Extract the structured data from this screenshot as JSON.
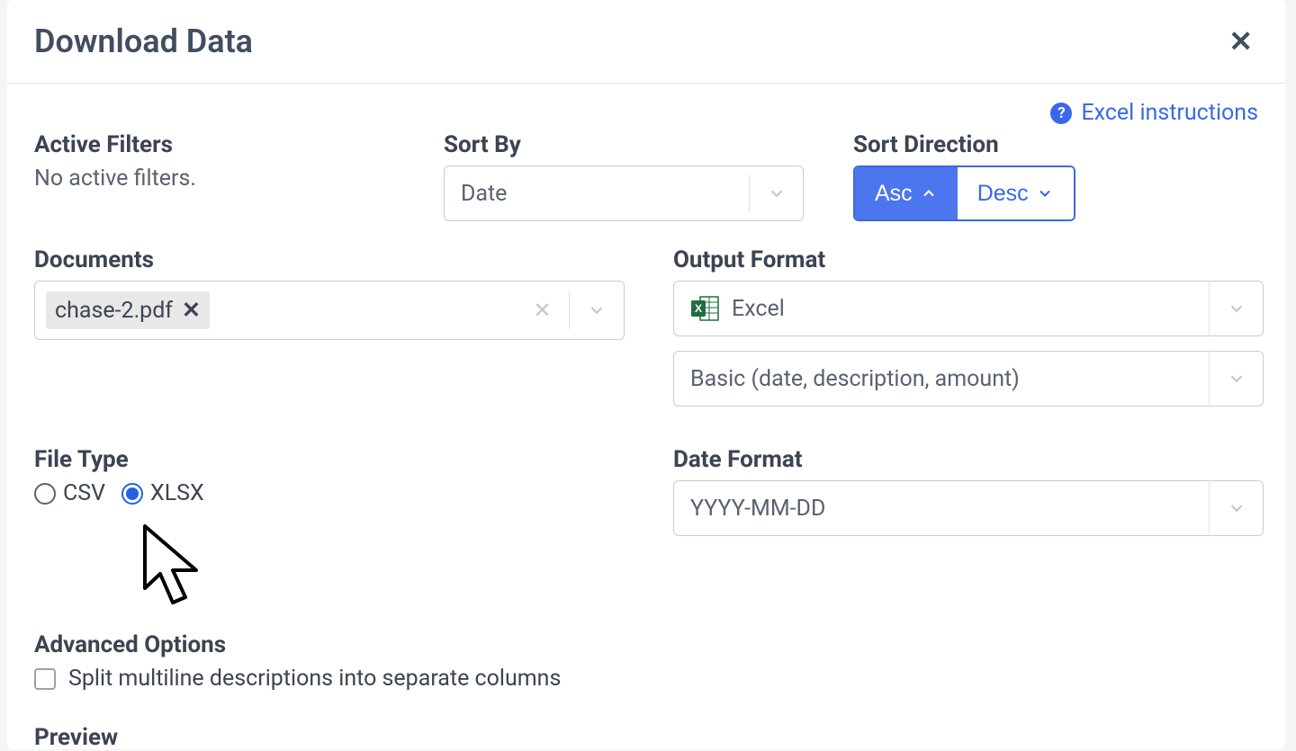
{
  "modal": {
    "title": "Download Data"
  },
  "help_link": {
    "label": "Excel instructions"
  },
  "active_filters": {
    "label": "Active Filters",
    "status": "No active filters."
  },
  "sort_by": {
    "label": "Sort By",
    "value": "Date"
  },
  "sort_direction": {
    "label": "Sort Direction",
    "asc": "Asc",
    "desc": "Desc",
    "selected": "asc"
  },
  "documents": {
    "label": "Documents",
    "selected": [
      {
        "name": "chase-2.pdf"
      }
    ]
  },
  "output_format": {
    "label": "Output Format",
    "type": "Excel",
    "template": "Basic (date, description, amount)"
  },
  "file_type": {
    "label": "File Type",
    "options": [
      {
        "value": "CSV",
        "checked": false
      },
      {
        "value": "XLSX",
        "checked": true
      }
    ]
  },
  "date_format": {
    "label": "Date Format",
    "value": "YYYY-MM-DD"
  },
  "advanced": {
    "label": "Advanced Options",
    "split_multiline": {
      "label": "Split multiline descriptions into separate columns",
      "checked": false
    }
  },
  "preview": {
    "label": "Preview"
  }
}
